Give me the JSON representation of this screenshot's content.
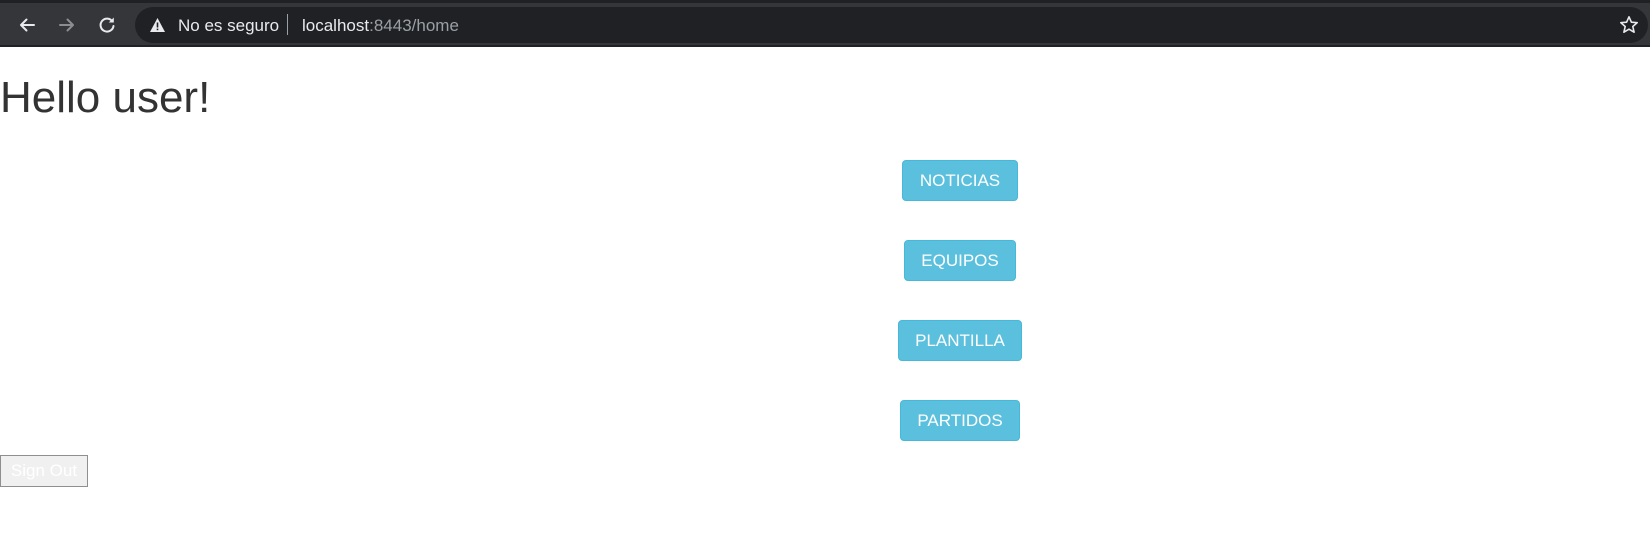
{
  "browser": {
    "security_label": "No es seguro",
    "url_host": "localhost",
    "url_rest": ":8443/home",
    "icons": {
      "back": "arrow-left-icon",
      "forward": "arrow-right-icon",
      "reload": "reload-icon",
      "security": "warning-triangle-icon",
      "bookmark": "star-icon"
    }
  },
  "page": {
    "greeting": "Hello user!",
    "menu": [
      {
        "label": "NOTICIAS"
      },
      {
        "label": "EQUIPOS"
      },
      {
        "label": "PLANTILLA"
      },
      {
        "label": "PARTIDOS"
      }
    ],
    "signout_label": "Sign Out"
  },
  "colors": {
    "chrome_bg": "#35363a",
    "omnibox_bg": "#202124",
    "button_info": "#5bc0de",
    "heading_text": "#333333"
  }
}
